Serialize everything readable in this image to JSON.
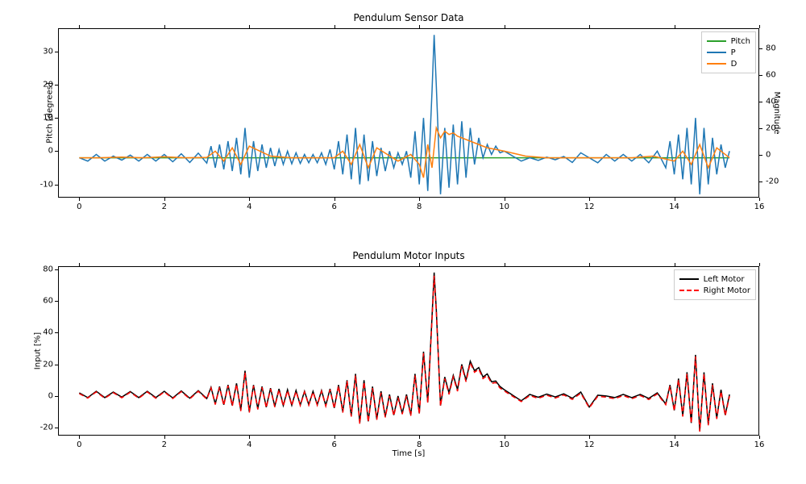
{
  "chart_data": [
    {
      "type": "line",
      "title": "Pendulum Sensor Data",
      "xlabel": "",
      "ylabel": "Pitch [degrees]",
      "ylabel_right": "Magnitude",
      "xlim": [
        -0.5,
        16
      ],
      "ylim": [
        -14,
        37
      ],
      "ylim_right": [
        -32,
        95
      ],
      "xticks": [
        0,
        2,
        4,
        6,
        8,
        10,
        12,
        14,
        16
      ],
      "yticks": [
        -10,
        0,
        10,
        20,
        30
      ],
      "yticks_right": [
        -20,
        0,
        20,
        40,
        60,
        80
      ],
      "legend": [
        "Pitch",
        "P",
        "D"
      ],
      "colors": {
        "Pitch": "#2ca02c",
        "P": "#1f77b4",
        "D": "#ff7f0e"
      },
      "series": [
        {
          "name": "Pitch",
          "axis": "left",
          "x": [
            0,
            15.3
          ],
          "y": [
            -2,
            -2
          ]
        },
        {
          "name": "P",
          "axis": "left",
          "x": [
            0.0,
            0.2,
            0.4,
            0.6,
            0.8,
            1.0,
            1.2,
            1.4,
            1.6,
            1.8,
            2.0,
            2.2,
            2.4,
            2.6,
            2.8,
            3.0,
            3.1,
            3.2,
            3.3,
            3.4,
            3.5,
            3.6,
            3.7,
            3.8,
            3.9,
            4.0,
            4.1,
            4.2,
            4.3,
            4.4,
            4.5,
            4.6,
            4.7,
            4.8,
            4.9,
            5.0,
            5.1,
            5.2,
            5.3,
            5.4,
            5.5,
            5.6,
            5.7,
            5.8,
            5.9,
            6.0,
            6.1,
            6.2,
            6.3,
            6.4,
            6.5,
            6.6,
            6.7,
            6.8,
            6.9,
            7.0,
            7.1,
            7.2,
            7.3,
            7.4,
            7.5,
            7.6,
            7.7,
            7.8,
            7.9,
            8.0,
            8.1,
            8.2,
            8.3,
            8.35,
            8.4,
            8.5,
            8.6,
            8.7,
            8.8,
            8.9,
            9.0,
            9.1,
            9.2,
            9.3,
            9.4,
            9.5,
            9.6,
            9.7,
            9.8,
            9.9,
            10.0,
            10.2,
            10.4,
            10.6,
            10.8,
            11.0,
            11.2,
            11.4,
            11.6,
            11.8,
            12.0,
            12.2,
            12.4,
            12.6,
            12.8,
            13.0,
            13.2,
            13.4,
            13.6,
            13.8,
            13.9,
            14.0,
            14.1,
            14.2,
            14.3,
            14.4,
            14.5,
            14.6,
            14.7,
            14.8,
            14.9,
            15.0,
            15.1,
            15.2,
            15.3
          ],
          "y": [
            -2,
            -3,
            -1,
            -3,
            -1.5,
            -2.7,
            -1.2,
            -3,
            -1,
            -3,
            -1,
            -3.2,
            -0.8,
            -3.4,
            -0.6,
            -3.6,
            1.5,
            -5,
            2,
            -5.5,
            3,
            -6,
            4,
            -7,
            7,
            -8,
            3,
            -6,
            2,
            -5,
            1,
            -4.5,
            0.5,
            -4,
            0,
            -3.8,
            -0.5,
            -3.7,
            -1,
            -3.5,
            -1,
            -3.5,
            -0.5,
            -4,
            0.5,
            -5.5,
            3,
            -7,
            5,
            -8.5,
            7,
            -10,
            5,
            -9,
            3,
            -7.5,
            1,
            -6,
            0,
            -5,
            -0.5,
            -4,
            0,
            -8,
            6,
            -10,
            10,
            -12,
            18,
            35,
            20,
            -13,
            7,
            -11,
            8,
            -10,
            9,
            -8,
            7,
            -4,
            4,
            -2,
            2,
            -1,
            1.5,
            -0.5,
            0,
            -1.5,
            -3,
            -2,
            -2.8,
            -1.8,
            -2.6,
            -1.6,
            -3.4,
            -0.5,
            -2,
            -3.5,
            -1,
            -3,
            -1,
            -3,
            -1,
            -3.5,
            0,
            -5,
            3,
            -7,
            5,
            -8.5,
            7,
            -10,
            10,
            -13,
            7,
            -10,
            4,
            -7,
            2,
            -5,
            0
          ]
        },
        {
          "name": "D",
          "axis": "left",
          "x": [
            0.0,
            0.5,
            1.0,
            1.5,
            2.0,
            2.5,
            3.0,
            3.2,
            3.4,
            3.6,
            3.8,
            4.0,
            4.5,
            5.0,
            5.5,
            6.0,
            6.2,
            6.4,
            6.6,
            6.8,
            7.0,
            7.5,
            7.8,
            8.0,
            8.1,
            8.2,
            8.3,
            8.4,
            8.5,
            8.6,
            8.7,
            8.8,
            8.9,
            9.0,
            9.2,
            9.4,
            9.6,
            9.8,
            10.0,
            10.5,
            11.0,
            11.5,
            12.0,
            12.5,
            13.0,
            13.5,
            14.0,
            14.2,
            14.4,
            14.6,
            14.8,
            15.0,
            15.3
          ],
          "y": [
            -2,
            -2,
            -1.8,
            -2,
            -1.7,
            -2,
            -1.9,
            0,
            -3,
            1,
            -4,
            1.5,
            -1.5,
            -2,
            -2,
            -2,
            0,
            -4,
            2,
            -5,
            1,
            -3,
            -1,
            -4,
            -8,
            2,
            -5,
            7,
            4,
            6,
            5,
            5.5,
            4.5,
            4,
            3,
            2,
            1,
            0.5,
            0,
            -1.5,
            -2,
            -2,
            -2,
            -2,
            -2,
            -1.5,
            -3,
            0,
            -4,
            2,
            -5,
            1,
            -2
          ]
        }
      ]
    },
    {
      "type": "line",
      "title": "Pendulum Motor Inputs",
      "xlabel": "Time [s]",
      "ylabel": "Input [%]",
      "xlim": [
        -0.5,
        16
      ],
      "ylim": [
        -25,
        82
      ],
      "xticks": [
        0,
        2,
        4,
        6,
        8,
        10,
        12,
        14,
        16
      ],
      "yticks": [
        -20,
        0,
        20,
        40,
        60,
        80
      ],
      "legend": [
        "Left Motor",
        "Right Motor"
      ],
      "colors": {
        "Left Motor": "#000000",
        "Right Motor": "#ff0000"
      },
      "dashes": {
        "Left Motor": "solid",
        "Right Motor": "dashed"
      },
      "series": [
        {
          "name": "Left Motor",
          "x": [
            0.0,
            0.2,
            0.4,
            0.6,
            0.8,
            1.0,
            1.2,
            1.4,
            1.6,
            1.8,
            2.0,
            2.2,
            2.4,
            2.6,
            2.8,
            3.0,
            3.1,
            3.2,
            3.3,
            3.4,
            3.5,
            3.6,
            3.7,
            3.8,
            3.9,
            4.0,
            4.1,
            4.2,
            4.3,
            4.4,
            4.5,
            4.6,
            4.7,
            4.8,
            4.9,
            5.0,
            5.1,
            5.2,
            5.3,
            5.4,
            5.5,
            5.6,
            5.7,
            5.8,
            5.9,
            6.0,
            6.1,
            6.2,
            6.3,
            6.4,
            6.5,
            6.6,
            6.7,
            6.8,
            6.9,
            7.0,
            7.1,
            7.2,
            7.3,
            7.4,
            7.5,
            7.6,
            7.7,
            7.8,
            7.9,
            8.0,
            8.1,
            8.2,
            8.3,
            8.35,
            8.4,
            8.5,
            8.6,
            8.7,
            8.8,
            8.9,
            9.0,
            9.1,
            9.2,
            9.3,
            9.4,
            9.5,
            9.6,
            9.7,
            9.8,
            9.9,
            10.0,
            10.2,
            10.4,
            10.6,
            10.8,
            11.0,
            11.2,
            11.4,
            11.6,
            11.8,
            12.0,
            12.2,
            12.4,
            12.6,
            12.8,
            13.0,
            13.2,
            13.4,
            13.6,
            13.8,
            13.9,
            14.0,
            14.1,
            14.2,
            14.3,
            14.4,
            14.5,
            14.6,
            14.7,
            14.8,
            14.9,
            15.0,
            15.1,
            15.2,
            15.3
          ],
          "y": [
            2,
            -1,
            3,
            -1,
            2.5,
            -0.7,
            2.8,
            -1,
            3,
            -1,
            3,
            -1.2,
            3.2,
            -1.4,
            3.4,
            -1.6,
            5.5,
            -5,
            6,
            -5.5,
            7,
            -6,
            8,
            -9,
            16,
            -10,
            7,
            -8,
            6,
            -7,
            5,
            -6.5,
            4.5,
            -6,
            4,
            -5.8,
            3.5,
            -5.7,
            3,
            -5.5,
            3,
            -5.5,
            3.5,
            -6,
            4.5,
            -7.5,
            7,
            -10,
            10,
            -12.5,
            14,
            -17,
            10,
            -16,
            6,
            -14.5,
            3,
            -13,
            1,
            -12,
            0,
            -11,
            1,
            -12,
            14,
            -11,
            28,
            -4,
            50,
            78,
            55,
            -6,
            12,
            2,
            13,
            4,
            20,
            10,
            22,
            16,
            18,
            12,
            14,
            9,
            9.5,
            6,
            4,
            0.5,
            -3,
            1,
            -0.8,
            1.2,
            -0.6,
            1.4,
            -1.4,
            2.5,
            -7,
            0.5,
            0,
            -1,
            1,
            -1,
            1,
            -1.5,
            2,
            -5,
            7,
            -9,
            11,
            -12.5,
            15,
            -17,
            26,
            -22,
            15,
            -18,
            8,
            -14,
            4,
            -12,
            1
          ]
        },
        {
          "name": "Right Motor",
          "x": [
            0.0,
            0.2,
            0.4,
            0.6,
            0.8,
            1.0,
            1.2,
            1.4,
            1.6,
            1.8,
            2.0,
            2.2,
            2.4,
            2.6,
            2.8,
            3.0,
            3.1,
            3.2,
            3.3,
            3.4,
            3.5,
            3.6,
            3.7,
            3.8,
            3.9,
            4.0,
            4.1,
            4.2,
            4.3,
            4.4,
            4.5,
            4.6,
            4.7,
            4.8,
            4.9,
            5.0,
            5.1,
            5.2,
            5.3,
            5.4,
            5.5,
            5.6,
            5.7,
            5.8,
            5.9,
            6.0,
            6.1,
            6.2,
            6.3,
            6.4,
            6.5,
            6.6,
            6.7,
            6.8,
            6.9,
            7.0,
            7.1,
            7.2,
            7.3,
            7.4,
            7.5,
            7.6,
            7.7,
            7.8,
            7.9,
            8.0,
            8.1,
            8.2,
            8.3,
            8.35,
            8.4,
            8.5,
            8.6,
            8.7,
            8.8,
            8.9,
            9.0,
            9.1,
            9.2,
            9.3,
            9.4,
            9.5,
            9.6,
            9.7,
            9.8,
            9.9,
            10.0,
            10.2,
            10.4,
            10.6,
            10.8,
            11.0,
            11.2,
            11.4,
            11.6,
            11.8,
            12.0,
            12.2,
            12.4,
            12.6,
            12.8,
            13.0,
            13.2,
            13.4,
            13.6,
            13.8,
            13.9,
            14.0,
            14.1,
            14.2,
            14.3,
            14.4,
            14.5,
            14.6,
            14.7,
            14.8,
            14.9,
            15.0,
            15.1,
            15.2,
            15.3
          ],
          "y": [
            1.5,
            -1.3,
            2.6,
            -1.4,
            2.1,
            -1.1,
            2.4,
            -1.4,
            2.6,
            -1.4,
            2.6,
            -1.6,
            2.8,
            -1.8,
            3.0,
            -2.0,
            5.0,
            -5.4,
            5.5,
            -6.0,
            6.5,
            -6.5,
            7.5,
            -9.5,
            15,
            -10.5,
            6.5,
            -8.5,
            5.5,
            -7.5,
            4.5,
            -7.0,
            4.0,
            -6.5,
            3.5,
            -6.2,
            3.0,
            -6.0,
            2.6,
            -5.8,
            2.6,
            -5.8,
            3.0,
            -6.4,
            4.0,
            -8.0,
            6.5,
            -10.5,
            9.5,
            -13.0,
            13.0,
            -17.5,
            9.0,
            -16.5,
            5.0,
            -15.0,
            2.0,
            -13.5,
            0.0,
            -12.5,
            -1.0,
            -11.5,
            0.0,
            -12.5,
            13.0,
            -11.5,
            27.0,
            -4.5,
            48.0,
            76.0,
            54.0,
            -6.5,
            11.0,
            1.0,
            12.0,
            3.0,
            19.0,
            9.0,
            21.0,
            15.0,
            17.0,
            11.0,
            13.0,
            8.0,
            8.5,
            5.0,
            3.2,
            -0.2,
            -3.5,
            0.3,
            -1.5,
            0.5,
            -1.3,
            0.7,
            -2.1,
            1.8,
            -7.5,
            -0.2,
            -0.7,
            -1.7,
            0.3,
            -1.7,
            0.3,
            -2.2,
            1.3,
            -5.5,
            6.3,
            -9.5,
            10.3,
            -13.0,
            14.0,
            -17.5,
            25.0,
            -22.5,
            14.0,
            -18.5,
            7.0,
            -14.5,
            3.0,
            -12.5,
            0.0
          ]
        }
      ]
    }
  ]
}
